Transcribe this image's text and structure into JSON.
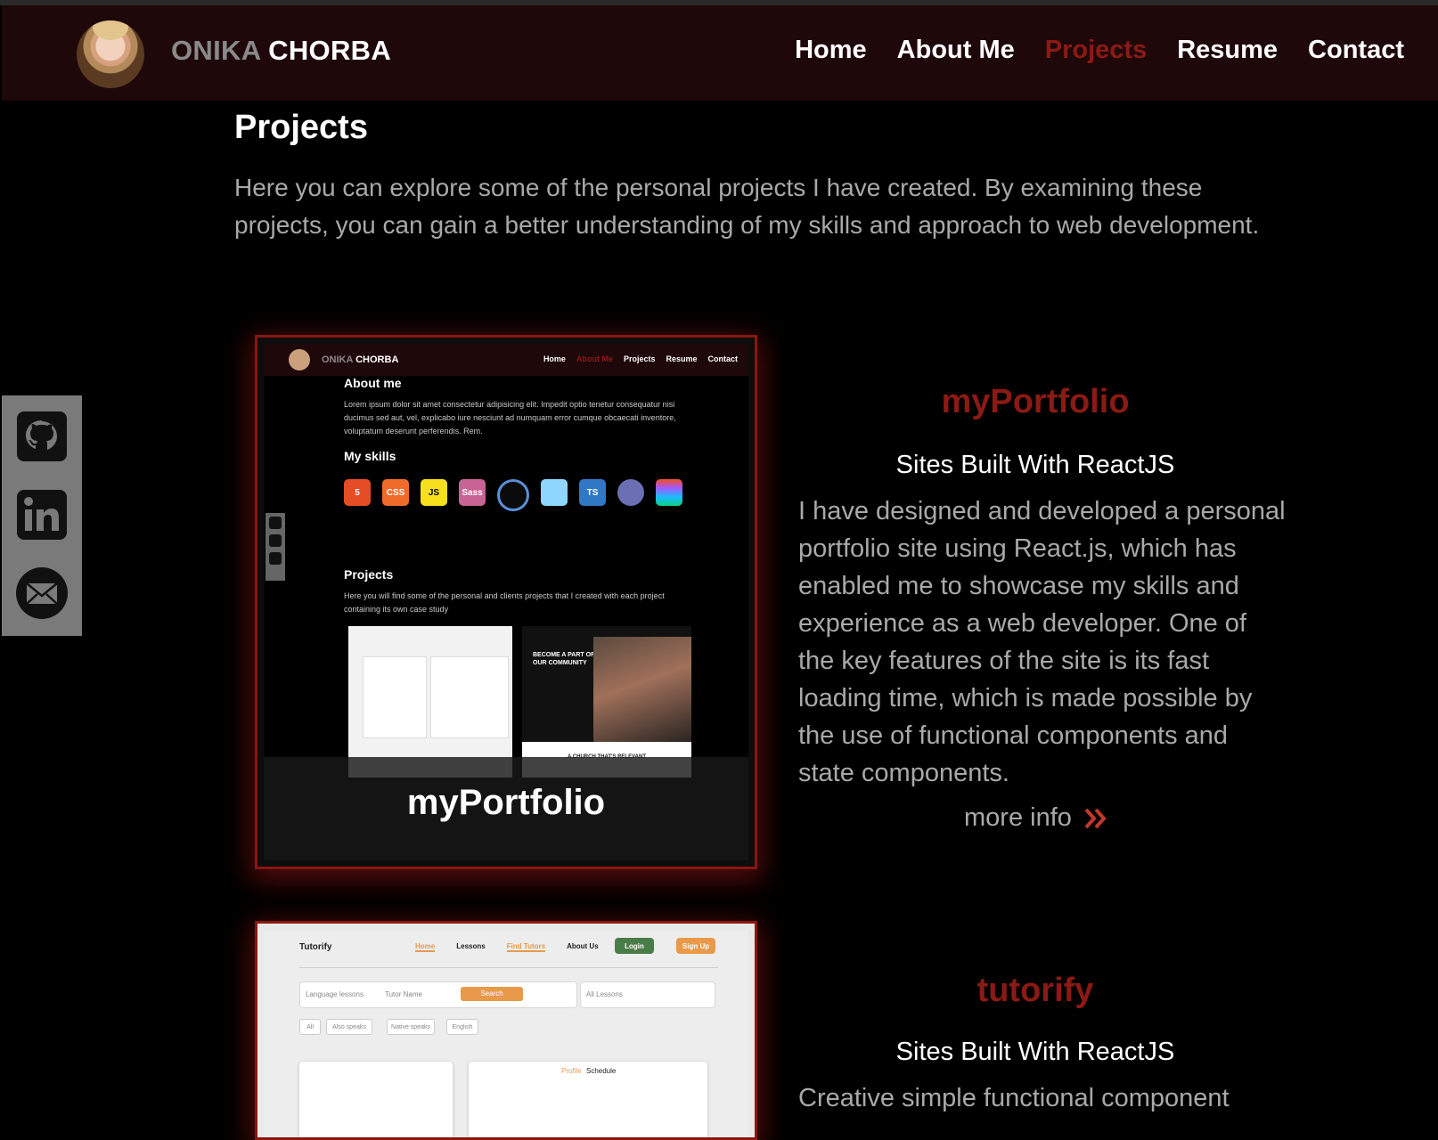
{
  "header": {
    "brand_first": "ONIKA",
    "brand_last": "CHORBA",
    "nav": [
      "Home",
      "About Me",
      "Projects",
      "Resume",
      "Contact"
    ],
    "active_nav": "Projects"
  },
  "page": {
    "title": "Projects",
    "intro": "Here you can explore some of the personal projects I have created. By examining these projects, you can gain a better understanding of my skills and approach to web development."
  },
  "social": [
    "github-icon",
    "linkedin-icon",
    "email-icon"
  ],
  "colors": {
    "accent": "#8b1a14",
    "header_bg": "#1f080a",
    "text_muted": "#a9a9a9",
    "social_bg": "#7a7a7a"
  },
  "projects": [
    {
      "card_label": "myPortfolio",
      "name": "myPortfolio",
      "subtitle": "Sites Built With ReactJS",
      "description": "I have designed and developed a personal portfolio site using React.js, which has enabled me to showcase my skills and experience as a web developer. One of the key features of the site is its fast loading time, which is made possible by the use of functional components and state components.",
      "more_label": "more info",
      "preview": {
        "brand_first": "ONIKA",
        "brand_last": "CHORBA",
        "nav": [
          "Home",
          "About Me",
          "Projects",
          "Resume",
          "Contact"
        ],
        "about_title": "About me",
        "about_text": "Lorem ipsum dolor sit amet consectetur adipisicing elit. Impedit optio tenetur consequatur nisi ducimus sed aut, vel, explicabo iure nesciunt ad numquam error cumque obcaecati inventore, voluptatum deserunt perferendis. Rem.",
        "skills_title": "My skills",
        "skills": [
          "5",
          "CSS",
          "JS",
          "Sass",
          "",
          "",
          "TS",
          "",
          ""
        ],
        "projects_title": "Projects",
        "projects_text": "Here you will find some of the personal and clients projects that I created with each project containing its own case study",
        "community_heading": "BECOME A PART OF OUR COMMUNITY",
        "church_text": "A CHURCH THAT'S RELEVANT"
      }
    },
    {
      "name": "tutorify",
      "subtitle": "Sites Built With ReactJS",
      "description": "Creative simple functional component",
      "preview": {
        "logo": "Tutorify",
        "nav": [
          "Home",
          "Lessons",
          "Find Tutors",
          "About Us"
        ],
        "login": "Login",
        "signup": "Sign Up",
        "search_a": "Language lessons",
        "search_b": "Tutor Name",
        "search_btn": "Search",
        "select": "All Lessons",
        "chips": [
          "All",
          "Also speaks",
          "Native speaks",
          "English"
        ],
        "tabs": [
          "Profile",
          "Schedule"
        ]
      }
    }
  ]
}
